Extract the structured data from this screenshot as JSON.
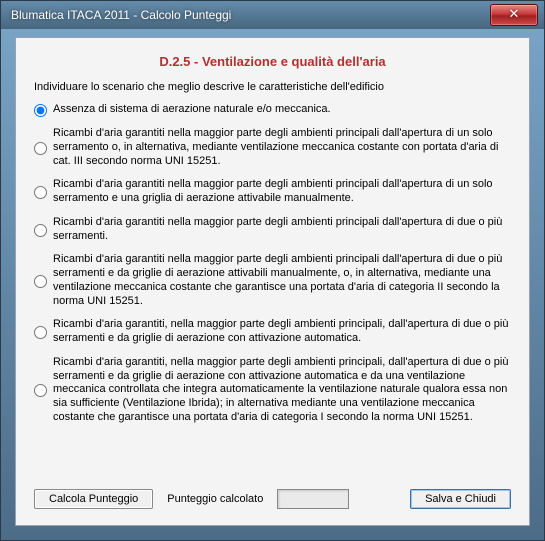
{
  "window": {
    "title": "Blumatica ITACA 2011 - Calcolo Punteggi"
  },
  "heading": "D.2.5 - Ventilazione e qualità dell'aria",
  "intro": "Individuare lo scenario che meglio descrive le caratteristiche dell'edificio",
  "options": [
    "Assenza di sistema di aerazione naturale e/o meccanica.",
    "Ricambi d'aria garantiti nella maggior parte degli ambienti principali dall'apertura di un solo serramento o, in alternativa, mediante ventilazione meccanica costante con portata d'aria di cat. III secondo norma UNI 15251.",
    "Ricambi d'aria garantiti nella maggior parte degli ambienti principali dall'apertura di un solo serramento e una griglia di aerazione attivabile manualmente.",
    "Ricambi d'aria garantiti nella maggior parte degli ambienti principali dall'apertura di due o più serramenti.",
    "Ricambi d'aria garantiti nella maggior parte degli ambienti principali dall'apertura di due o più serramenti e da griglie di aerazione attivabili manualmente, o, in alternativa, mediante una ventilazione meccanica costante che garantisce una portata d'aria di categoria II secondo la norma UNI 15251.",
    "Ricambi d'aria garantiti, nella maggior parte degli ambienti principali, dall'apertura di due o più serramenti e da griglie di aerazione con attivazione automatica.",
    "Ricambi d'aria garantiti, nella maggior parte degli ambienti principali, dall'apertura di due o più serramenti e da griglie di aerazione con attivazione automatica e da una ventilazione meccanica controllata che integra automaticamente la ventilazione naturale qualora essa non sia sufficiente (Ventilazione Ibrida); in alternativa mediante una ventilazione meccanica costante che garantisce una portata d'aria di categoria I secondo la norma UNI 15251."
  ],
  "selected_index": 0,
  "buttons": {
    "calc": "Calcola Punteggio",
    "score_label": "Punteggio calcolato",
    "save": "Salva e Chiudi"
  },
  "score_value": ""
}
